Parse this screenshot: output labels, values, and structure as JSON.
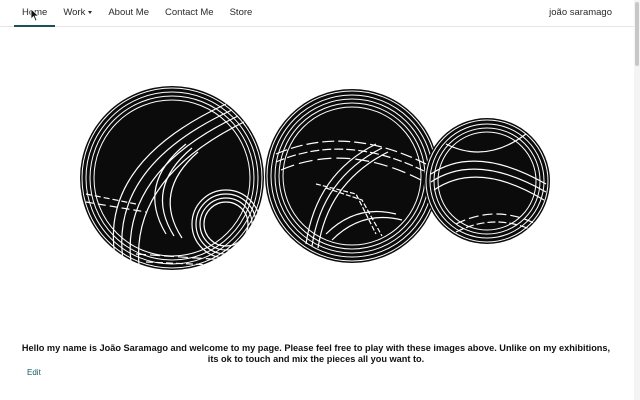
{
  "nav": {
    "items": [
      {
        "label": "Home"
      },
      {
        "label": "Work"
      },
      {
        "label": "About Me"
      },
      {
        "label": "Contact Me"
      },
      {
        "label": "Store"
      }
    ],
    "brand": "joão saramago"
  },
  "main": {
    "intro": "Hello my name is João Saramago and welcome to my page. Please feel free to play with these images above. Unlike on my exhibitions, its ok to touch and mix the pieces all you want to.",
    "edit_label": "Edit"
  },
  "colors": {
    "accent": "#1a4f5c",
    "link": "#1a5a66",
    "text": "#2b2b2b"
  },
  "icons": {
    "dropdown": "caret-down-icon",
    "cursor": "mouse-pointer-icon"
  }
}
